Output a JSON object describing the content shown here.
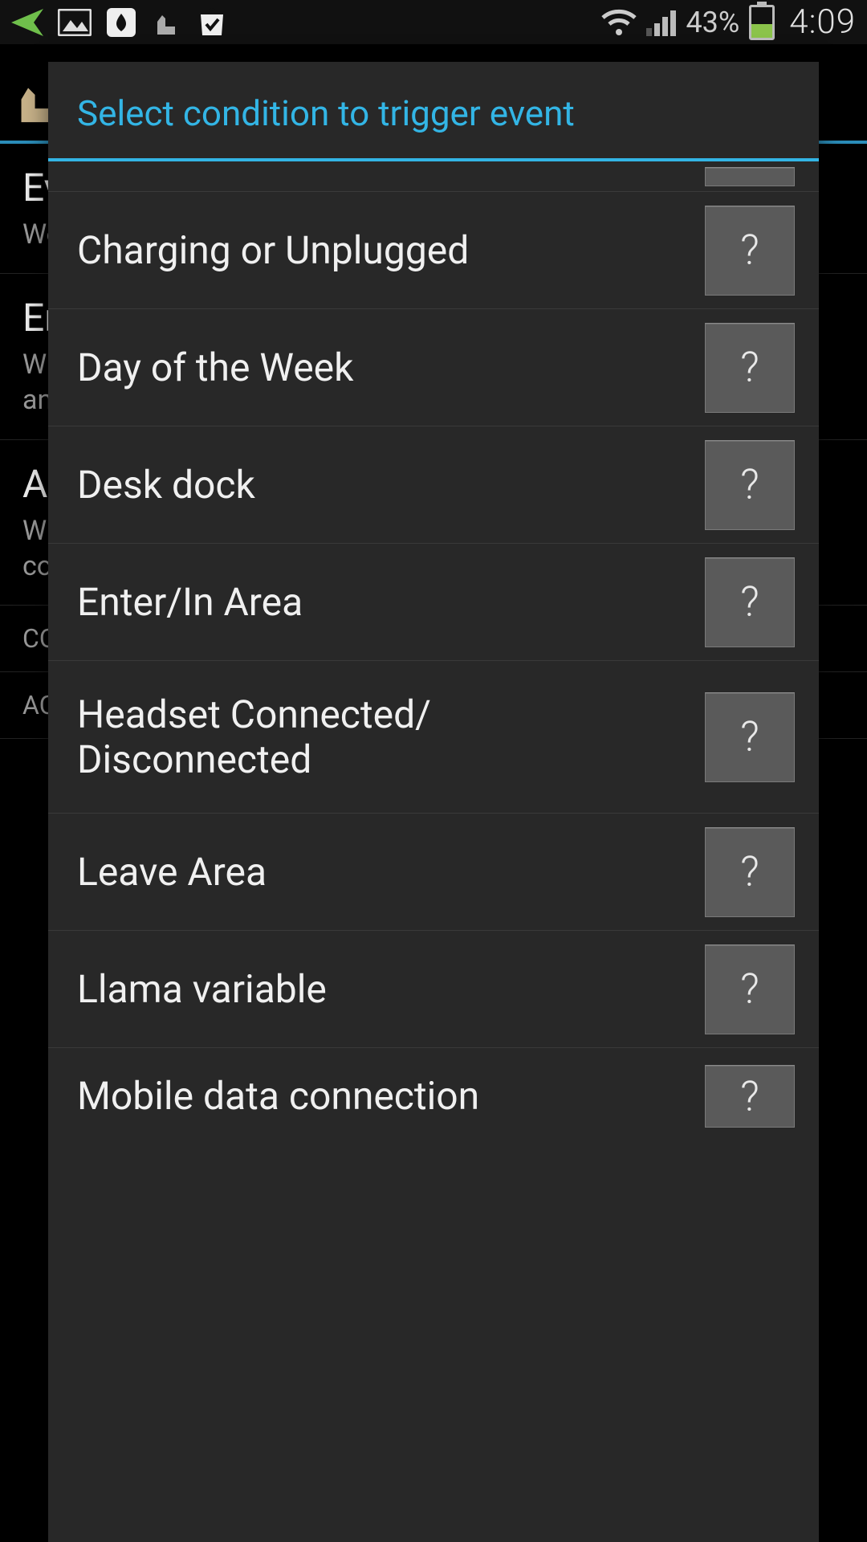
{
  "status": {
    "battery_pct": "43%",
    "clock": "4:09"
  },
  "background": {
    "sections": [
      {
        "title": "Ev",
        "sub": "Wo"
      },
      {
        "title": "En",
        "sub": "Wh\nand"
      },
      {
        "title": "A",
        "sub": "W\nco"
      }
    ],
    "headings": [
      "CO",
      "AC"
    ]
  },
  "dialog": {
    "title": "Select condition to trigger event",
    "help_glyph": "?",
    "conditions": [
      {
        "label": "Charging or Unplugged"
      },
      {
        "label": "Day of the Week"
      },
      {
        "label": "Desk dock"
      },
      {
        "label": "Enter/In Area"
      },
      {
        "label": "Headset Connected/\nDisconnected"
      },
      {
        "label": "Leave Area"
      },
      {
        "label": "Llama variable"
      },
      {
        "label": "Mobile data connection"
      }
    ]
  }
}
